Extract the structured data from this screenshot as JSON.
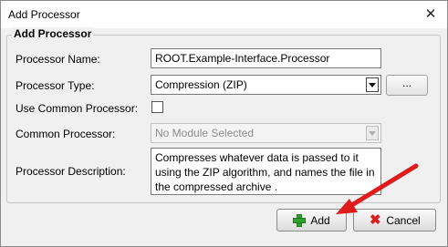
{
  "window": {
    "title": "Add Processor",
    "close_glyph": "✕"
  },
  "group": {
    "legend": "Add Processor"
  },
  "form": {
    "name_label": "Processor Name:",
    "name_value": "ROOT.Example-Interface.Processor",
    "type_label": "Processor Type:",
    "type_value": "Compression (ZIP)",
    "browse_label": "...",
    "use_common_label": "Use Common Processor:",
    "use_common_checked": false,
    "common_label": "Common Processor:",
    "common_value": "No Module Selected",
    "desc_label": "Processor Description:",
    "desc_value": "Compresses whatever data is passed to it using the ZIP algorithm, and names the file in the compressed archive ."
  },
  "buttons": {
    "add_label": "Add",
    "cancel_label": "Cancel"
  },
  "annotation": {
    "arrow_color": "#e01b1b"
  }
}
